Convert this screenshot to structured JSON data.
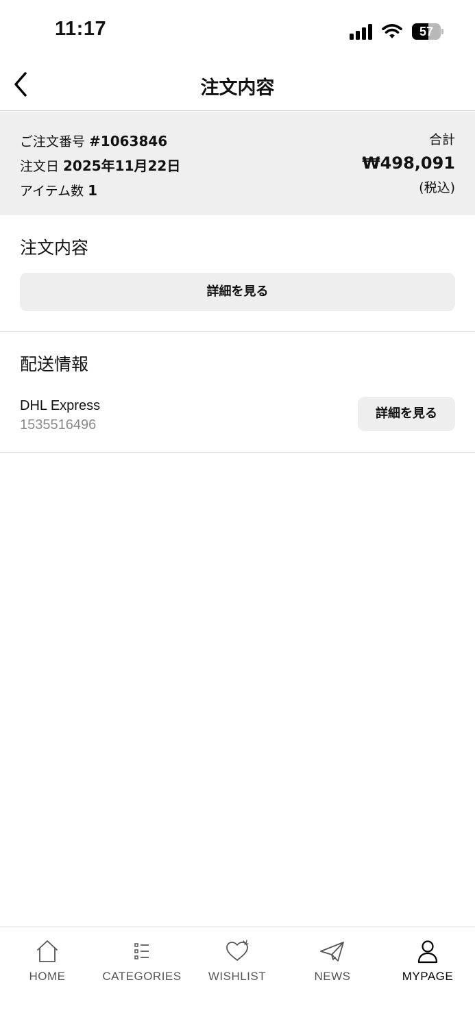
{
  "status_bar": {
    "time": "11:17",
    "battery": "57",
    "battery_level": 0.57
  },
  "header": {
    "title": "注文内容",
    "back_icon": "chevron-left-icon"
  },
  "summary": {
    "order_number_label": "ご注文番号",
    "order_number": "#1063846",
    "order_date_label": "注文日",
    "order_date": "2025年11月22日",
    "item_count_label": "アイテム数",
    "item_count": "1",
    "total_label": "合計",
    "total_value": "₩498,091",
    "tax_note": "(税込)"
  },
  "order_section": {
    "title": "注文内容",
    "details_button": "詳細を見る"
  },
  "shipping_section": {
    "title": "配送情報",
    "carrier": "DHL Express",
    "tracking_number": "1535516496",
    "details_button": "詳細を見る"
  },
  "bottom_nav": {
    "items": [
      {
        "label": "HOME",
        "icon": "home-icon"
      },
      {
        "label": "CATEGORIES",
        "icon": "list-icon"
      },
      {
        "label": "WISHLIST",
        "icon": "heart-icon"
      },
      {
        "label": "NEWS",
        "icon": "paper-plane-icon"
      },
      {
        "label": "MYPAGE",
        "icon": "user-icon",
        "active": true
      }
    ]
  }
}
